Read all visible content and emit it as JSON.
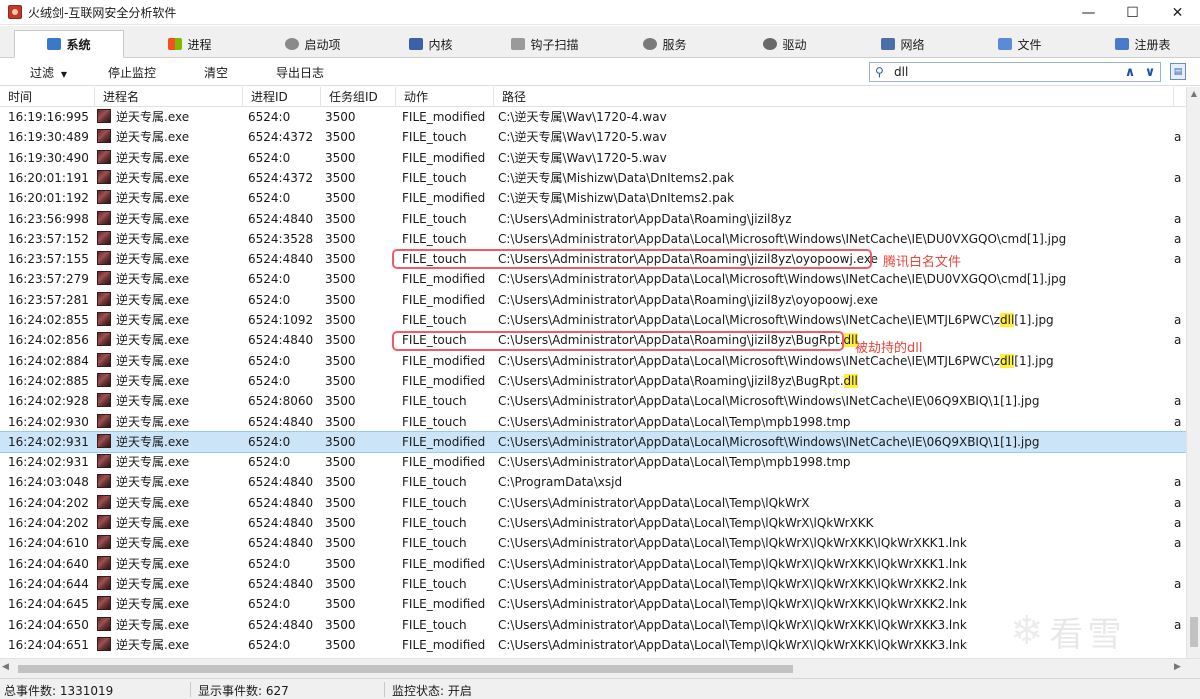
{
  "window": {
    "title": "火绒剑-互联网安全分析软件",
    "minimize": "—",
    "maximize": "☐",
    "close": "✕"
  },
  "tabs": [
    {
      "label": "系统",
      "icon": "system-icon",
      "active": true
    },
    {
      "label": "进程",
      "icon": "windows-flag-icon"
    },
    {
      "label": "启动项",
      "icon": "gear-icon"
    },
    {
      "label": "内核",
      "icon": "hammer-icon"
    },
    {
      "label": "钩子扫描",
      "icon": "hook-icon"
    },
    {
      "label": "服务",
      "icon": "gears-icon"
    },
    {
      "label": "驱动",
      "icon": "driver-gear-icon"
    },
    {
      "label": "网络",
      "icon": "network-icon"
    },
    {
      "label": "文件",
      "icon": "file-icon"
    },
    {
      "label": "注册表",
      "icon": "registry-icon"
    }
  ],
  "toolbar": {
    "filter": "过滤",
    "stop_monitor": "停止监控",
    "clear": "清空",
    "export_log": "导出日志"
  },
  "search": {
    "value": "dll"
  },
  "columns": [
    "时间",
    "进程名",
    "进程ID",
    "任务组ID",
    "动作",
    "路径"
  ],
  "rows": [
    {
      "time": "16:19:16:995",
      "proc": "逆天专属.exe",
      "pid": "6524:0",
      "tgid": "3500",
      "action": "FILE_modified",
      "path": [
        "C:\\逆天专属\\Wav\\1720-4.wav"
      ],
      "extra": ""
    },
    {
      "time": "16:19:30:489",
      "proc": "逆天专属.exe",
      "pid": "6524:4372",
      "tgid": "3500",
      "action": "FILE_touch",
      "path": [
        "C:\\逆天专属\\Wav\\1720-5.wav"
      ],
      "extra": "a"
    },
    {
      "time": "16:19:30:490",
      "proc": "逆天专属.exe",
      "pid": "6524:0",
      "tgid": "3500",
      "action": "FILE_modified",
      "path": [
        "C:\\逆天专属\\Wav\\1720-5.wav"
      ],
      "extra": ""
    },
    {
      "time": "16:20:01:191",
      "proc": "逆天专属.exe",
      "pid": "6524:4372",
      "tgid": "3500",
      "action": "FILE_touch",
      "path": [
        "C:\\逆天专属\\Mishizw\\Data\\DnItems2.pak"
      ],
      "extra": "a"
    },
    {
      "time": "16:20:01:192",
      "proc": "逆天专属.exe",
      "pid": "6524:0",
      "tgid": "3500",
      "action": "FILE_modified",
      "path": [
        "C:\\逆天专属\\Mishizw\\Data\\DnItems2.pak"
      ],
      "extra": ""
    },
    {
      "time": "16:23:56:998",
      "proc": "逆天专属.exe",
      "pid": "6524:4840",
      "tgid": "3500",
      "action": "FILE_touch",
      "path": [
        "C:\\Users\\Administrator\\AppData\\Roaming\\jizil8yz"
      ],
      "extra": "a"
    },
    {
      "time": "16:23:57:152",
      "proc": "逆天专属.exe",
      "pid": "6524:3528",
      "tgid": "3500",
      "action": "FILE_touch",
      "path": [
        "C:\\Users\\Administrator\\AppData\\Local\\Microsoft\\Windows\\INetCache\\IE\\DU0VXGQO\\cmd[1].jpg"
      ],
      "extra": "a"
    },
    {
      "time": "16:23:57:155",
      "proc": "逆天专属.exe",
      "pid": "6524:4840",
      "tgid": "3500",
      "action": "FILE_touch",
      "path": [
        "C:\\Users\\Administrator\\AppData\\Roaming\\jizil8yz\\oyopoowj.exe"
      ],
      "extra": "a"
    },
    {
      "time": "16:23:57:279",
      "proc": "逆天专属.exe",
      "pid": "6524:0",
      "tgid": "3500",
      "action": "FILE_modified",
      "path": [
        "C:\\Users\\Administrator\\AppData\\Local\\Microsoft\\Windows\\INetCache\\IE\\DU0VXGQO\\cmd[1].jpg"
      ],
      "extra": ""
    },
    {
      "time": "16:23:57:281",
      "proc": "逆天专属.exe",
      "pid": "6524:0",
      "tgid": "3500",
      "action": "FILE_modified",
      "path": [
        "C:\\Users\\Administrator\\AppData\\Roaming\\jizil8yz\\oyopoowj.exe"
      ],
      "extra": ""
    },
    {
      "time": "16:24:02:855",
      "proc": "逆天专属.exe",
      "pid": "6524:1092",
      "tgid": "3500",
      "action": "FILE_touch",
      "path": [
        "C:\\Users\\Administrator\\AppData\\Local\\Microsoft\\Windows\\INetCache\\IE\\MTJL6PWC\\z",
        "dll",
        "[1].jpg"
      ],
      "extra": "a"
    },
    {
      "time": "16:24:02:856",
      "proc": "逆天专属.exe",
      "pid": "6524:4840",
      "tgid": "3500",
      "action": "FILE_touch",
      "path": [
        "C:\\Users\\Administrator\\AppData\\Roaming\\jizil8yz\\BugRpt.",
        "dll",
        ""
      ],
      "extra": "a"
    },
    {
      "time": "16:24:02:884",
      "proc": "逆天专属.exe",
      "pid": "6524:0",
      "tgid": "3500",
      "action": "FILE_modified",
      "path": [
        "C:\\Users\\Administrator\\AppData\\Local\\Microsoft\\Windows\\INetCache\\IE\\MTJL6PWC\\z",
        "dll",
        "[1].jpg"
      ],
      "extra": ""
    },
    {
      "time": "16:24:02:885",
      "proc": "逆天专属.exe",
      "pid": "6524:0",
      "tgid": "3500",
      "action": "FILE_modified",
      "path": [
        "C:\\Users\\Administrator\\AppData\\Roaming\\jizil8yz\\BugRpt.",
        "dll",
        ""
      ],
      "extra": ""
    },
    {
      "time": "16:24:02:928",
      "proc": "逆天专属.exe",
      "pid": "6524:8060",
      "tgid": "3500",
      "action": "FILE_touch",
      "path": [
        "C:\\Users\\Administrator\\AppData\\Local\\Microsoft\\Windows\\INetCache\\IE\\06Q9XBIQ\\1[1].jpg"
      ],
      "extra": "a"
    },
    {
      "time": "16:24:02:930",
      "proc": "逆天专属.exe",
      "pid": "6524:4840",
      "tgid": "3500",
      "action": "FILE_touch",
      "path": [
        "C:\\Users\\Administrator\\AppData\\Local\\Temp\\mpb1998.tmp"
      ],
      "extra": "a"
    },
    {
      "time": "16:24:02:931",
      "proc": "逆天专属.exe",
      "pid": "6524:0",
      "tgid": "3500",
      "action": "FILE_modified",
      "path": [
        "C:\\Users\\Administrator\\AppData\\Local\\Microsoft\\Windows\\INetCache\\IE\\06Q9XBIQ\\1[1].jpg"
      ],
      "extra": "",
      "selected": true
    },
    {
      "time": "16:24:02:931",
      "proc": "逆天专属.exe",
      "pid": "6524:0",
      "tgid": "3500",
      "action": "FILE_modified",
      "path": [
        "C:\\Users\\Administrator\\AppData\\Local\\Temp\\mpb1998.tmp"
      ],
      "extra": ""
    },
    {
      "time": "16:24:03:048",
      "proc": "逆天专属.exe",
      "pid": "6524:4840",
      "tgid": "3500",
      "action": "FILE_touch",
      "path": [
        "C:\\ProgramData\\xsjd"
      ],
      "extra": "a"
    },
    {
      "time": "16:24:04:202",
      "proc": "逆天专属.exe",
      "pid": "6524:4840",
      "tgid": "3500",
      "action": "FILE_touch",
      "path": [
        "C:\\Users\\Administrator\\AppData\\Local\\Temp\\lQkWrX"
      ],
      "extra": "a"
    },
    {
      "time": "16:24:04:202",
      "proc": "逆天专属.exe",
      "pid": "6524:4840",
      "tgid": "3500",
      "action": "FILE_touch",
      "path": [
        "C:\\Users\\Administrator\\AppData\\Local\\Temp\\lQkWrX\\lQkWrXKK"
      ],
      "extra": "a"
    },
    {
      "time": "16:24:04:610",
      "proc": "逆天专属.exe",
      "pid": "6524:4840",
      "tgid": "3500",
      "action": "FILE_touch",
      "path": [
        "C:\\Users\\Administrator\\AppData\\Local\\Temp\\lQkWrX\\lQkWrXKK\\lQkWrXKK1.lnk"
      ],
      "extra": "a"
    },
    {
      "time": "16:24:04:640",
      "proc": "逆天专属.exe",
      "pid": "6524:0",
      "tgid": "3500",
      "action": "FILE_modified",
      "path": [
        "C:\\Users\\Administrator\\AppData\\Local\\Temp\\lQkWrX\\lQkWrXKK\\lQkWrXKK1.lnk"
      ],
      "extra": ""
    },
    {
      "time": "16:24:04:644",
      "proc": "逆天专属.exe",
      "pid": "6524:4840",
      "tgid": "3500",
      "action": "FILE_touch",
      "path": [
        "C:\\Users\\Administrator\\AppData\\Local\\Temp\\lQkWrX\\lQkWrXKK\\lQkWrXKK2.lnk"
      ],
      "extra": "a"
    },
    {
      "time": "16:24:04:645",
      "proc": "逆天专属.exe",
      "pid": "6524:0",
      "tgid": "3500",
      "action": "FILE_modified",
      "path": [
        "C:\\Users\\Administrator\\AppData\\Local\\Temp\\lQkWrX\\lQkWrXKK\\lQkWrXKK2.lnk"
      ],
      "extra": ""
    },
    {
      "time": "16:24:04:650",
      "proc": "逆天专属.exe",
      "pid": "6524:4840",
      "tgid": "3500",
      "action": "FILE_touch",
      "path": [
        "C:\\Users\\Administrator\\AppData\\Local\\Temp\\lQkWrX\\lQkWrXKK\\lQkWrXKK3.lnk"
      ],
      "extra": "a"
    },
    {
      "time": "16:24:04:651",
      "proc": "逆天专属.exe",
      "pid": "6524:0",
      "tgid": "3500",
      "action": "FILE_modified",
      "path": [
        "C:\\Users\\Administrator\\AppData\\Local\\Temp\\lQkWrX\\lQkWrXKK\\lQkWrXKK3.lnk"
      ],
      "extra": ""
    }
  ],
  "annotations": {
    "whitelist_label": "腾讯白名文件",
    "hijacked_label": "被劫持的dll"
  },
  "status": {
    "total_events": "总事件数: 1331019",
    "shown_events": "显示事件数: 627",
    "monitor_state": "监控状态: 开启"
  },
  "watermark": {
    "text": "看雪"
  },
  "colors": {
    "selected_row": "#cce4f7",
    "search_highlight": "#ffef3a",
    "callout_red": "#f25a6a"
  }
}
